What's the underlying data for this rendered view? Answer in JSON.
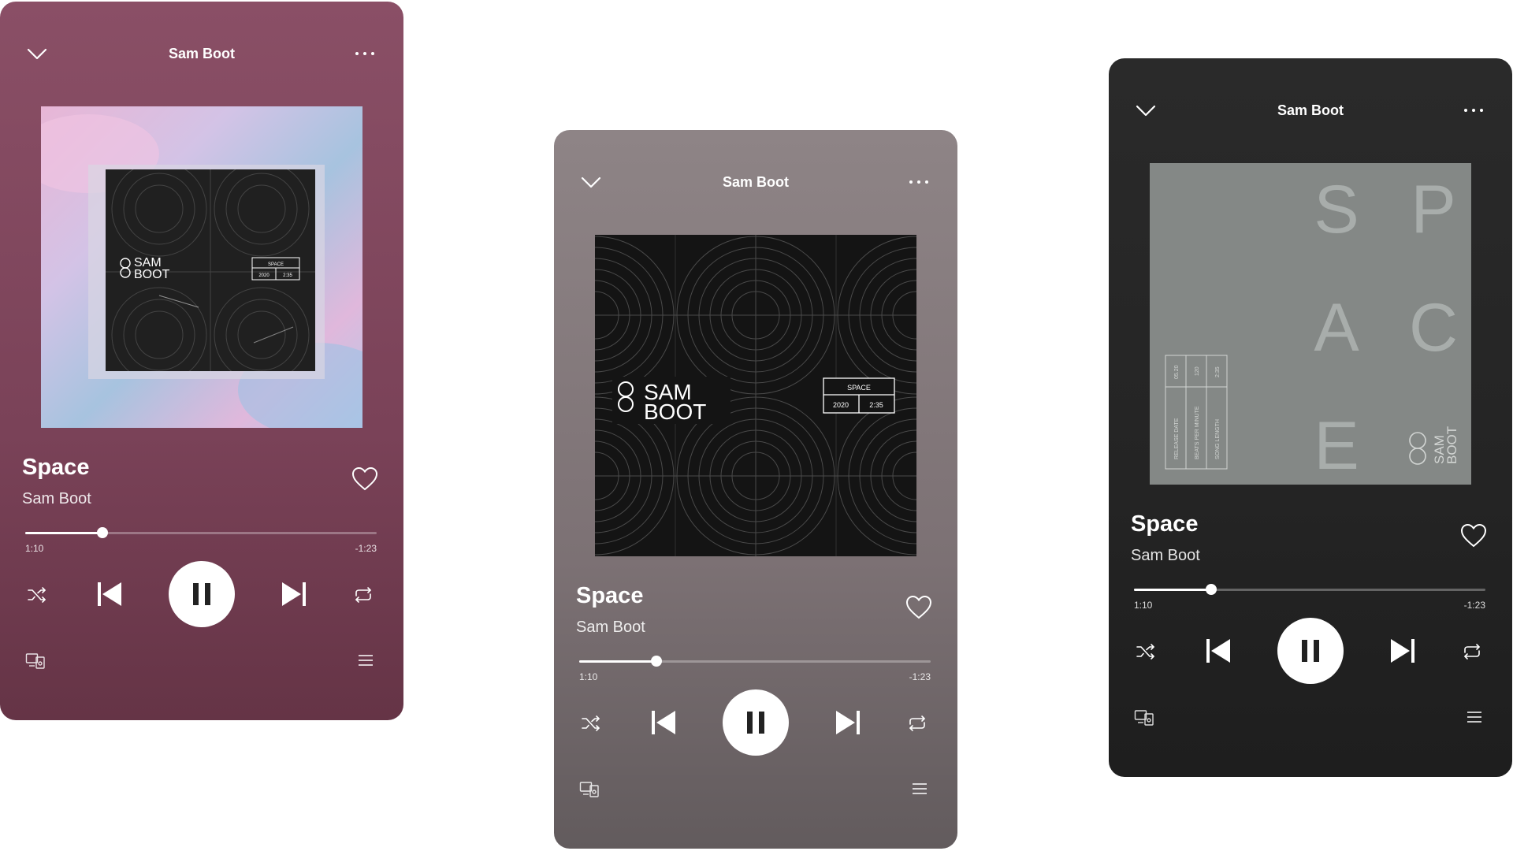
{
  "players": [
    {
      "id": "p1",
      "variant": "plum",
      "header_title": "Sam Boot",
      "track_title": "Space",
      "artist": "Sam Boot",
      "progress_fraction": 0.22,
      "elapsed": "1:10",
      "remaining": "-1:23",
      "artwork": "cd-case-on-pastel-background"
    },
    {
      "id": "p2",
      "variant": "taupe",
      "header_title": "Sam Boot",
      "track_title": "Space",
      "artist": "Sam Boot",
      "progress_fraction": 0.22,
      "elapsed": "1:10",
      "remaining": "-1:23",
      "artwork": "black-circles-cover"
    },
    {
      "id": "p3",
      "variant": "dark",
      "header_title": "Sam Boot",
      "track_title": "Space",
      "artist": "Sam Boot",
      "progress_fraction": 0.22,
      "elapsed": "1:10",
      "remaining": "-1:23",
      "artwork": "grey-space-letters-cover"
    }
  ],
  "artwork_text": {
    "logo_line1": "SAM",
    "logo_line2": "BOOT",
    "box_title": "SPACE",
    "box_year": "2020",
    "box_length": "2:35",
    "letters": [
      "S",
      "P",
      "A",
      "C",
      "E"
    ],
    "spec_values": [
      "05.20",
      "120",
      "2:35"
    ],
    "spec_labels": [
      "RELEASE DATE",
      "BEATS PER MINUTE",
      "SONG LENGTH"
    ]
  },
  "icons": [
    "chevron-down-icon",
    "more-options-icon",
    "heart-icon",
    "shuffle-icon",
    "skip-previous-icon",
    "pause-icon",
    "skip-next-icon",
    "repeat-icon",
    "devices-icon",
    "queue-icon"
  ],
  "colors": {
    "plum": "#86495f",
    "taupe": "#877c7f",
    "dark": "#262626",
    "foreground": "#ffffff"
  }
}
